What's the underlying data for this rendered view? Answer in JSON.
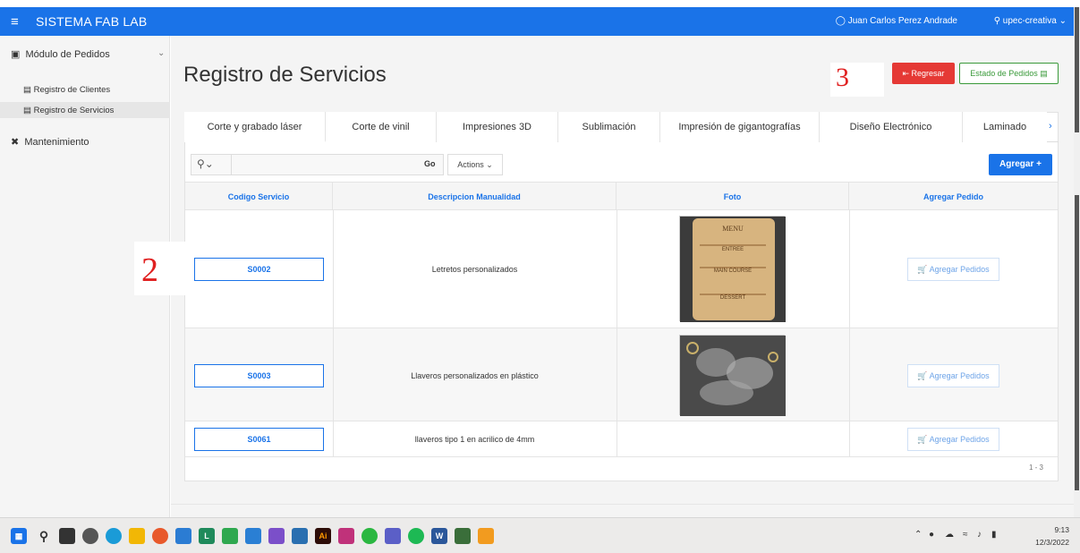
{
  "header": {
    "app_title": "SISTEMA FAB LAB",
    "user": "Juan Carlos Perez Andrade",
    "workspace": "upec-creativa"
  },
  "sidebar": {
    "items": [
      {
        "label": "Módulo de Pedidos"
      },
      {
        "label": "Registro de Clientes"
      },
      {
        "label": "Registro de Servicios"
      },
      {
        "label": "Mantenimiento"
      }
    ]
  },
  "page": {
    "title": "Registro de Servicios",
    "btn_regresar": "Regresar",
    "btn_estado": "Estado de Pedidos",
    "annotation_3": "3",
    "annotation_2": "2"
  },
  "tabs": [
    {
      "label": "Corte y grabado láser"
    },
    {
      "label": "Corte de vinil"
    },
    {
      "label": "Impresiones 3D"
    },
    {
      "label": "Sublimación"
    },
    {
      "label": "Impresión de gigantografías"
    },
    {
      "label": "Diseño Electrónico"
    },
    {
      "label": "Laminado"
    }
  ],
  "toolbar": {
    "go": "Go",
    "actions": "Actions",
    "agregar": "Agregar +"
  },
  "table": {
    "headers": [
      "Codigo Servicio",
      "Descripcion Manualidad",
      "Foto",
      "Agregar Pedido"
    ],
    "rows": [
      {
        "code": "S0002",
        "desc": "Letretos personalizados",
        "action": "Agregar Pedidos"
      },
      {
        "code": "S0003",
        "desc": "Llaveros personalizados en plástico",
        "action": "Agregar Pedidos"
      },
      {
        "code": "S0061",
        "desc": "llaveros tipo 1 en acrilico de 4mm",
        "action": "Agregar Pedidos"
      }
    ],
    "pagination": "1 - 3"
  },
  "photo1_text": {
    "menu": "MENU",
    "entree": "ENTREE",
    "main": "MAIN COURSE",
    "dessert": "DESSERT"
  },
  "taskbar": {
    "time": "9:13",
    "date": "12/3/2022"
  }
}
